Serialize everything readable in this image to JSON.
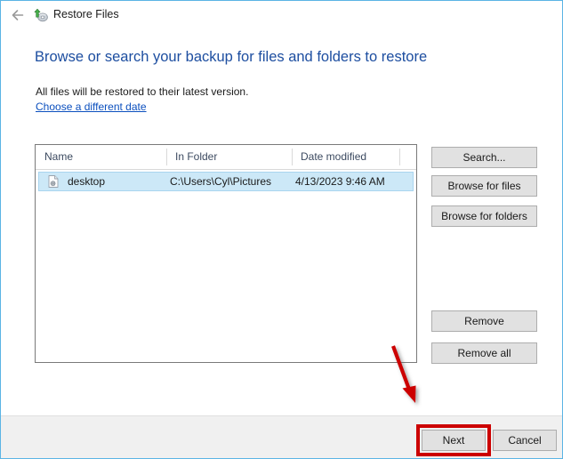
{
  "window": {
    "title": "Restore Files",
    "title_icon": "restore-disk-icon",
    "back_icon": "back-arrow-icon",
    "border_color": "#5BB4E5"
  },
  "header": {
    "page_title": "Browse or search your backup for files and folders to restore",
    "page_title_color": "#1D4EA0",
    "subtitle": "All files will be restored to their latest version.",
    "link_label": "Choose a different date",
    "link_color": "#0B4FBE"
  },
  "file_list": {
    "columns": [
      "Name",
      "In Folder",
      "Date modified"
    ],
    "rows": [
      {
        "icon": "ini-file-icon",
        "name": "desktop",
        "in_folder": "C:\\Users\\Cyl\\Pictures",
        "date_modified": "4/13/2023 9:46 AM",
        "selected": true
      }
    ],
    "selection_color": "#CCE8F7"
  },
  "side_buttons": {
    "search": "Search...",
    "browse_for_files": "Browse for files",
    "browse_for_folders": "Browse for folders",
    "remove": "Remove",
    "remove_all": "Remove all"
  },
  "footer": {
    "next": "Next",
    "cancel": "Cancel"
  },
  "annotations": {
    "highlight_color": "#CC0000",
    "highlight_target": "Next",
    "arrow_color": "#CC0000",
    "arrow_points_to": "Next"
  }
}
